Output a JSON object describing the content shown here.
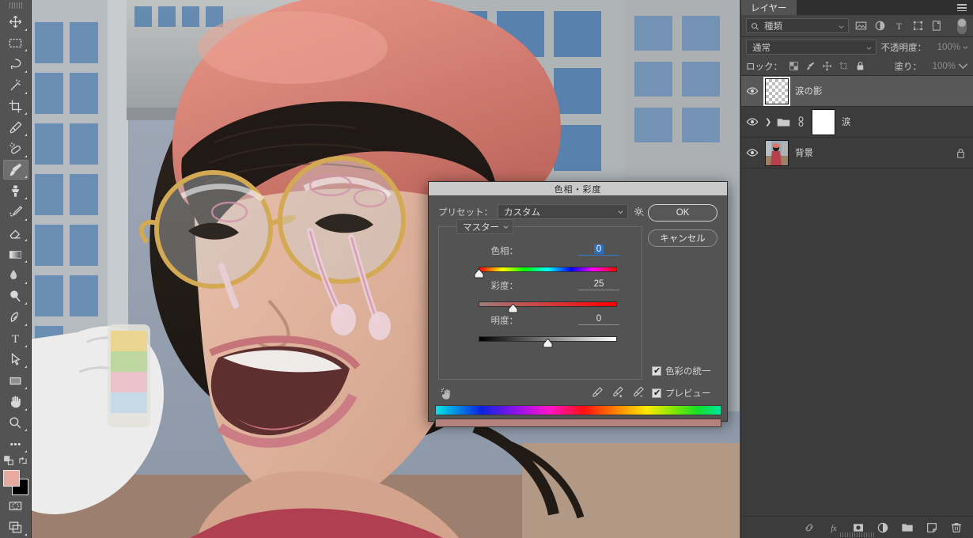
{
  "app": {
    "toolbar": {
      "tools": [
        {
          "name": "move-tool",
          "label": "移動ツール",
          "selected": false
        },
        {
          "name": "marquee-tool",
          "label": "長方形選択ツール",
          "selected": false
        },
        {
          "name": "lasso-tool",
          "label": "なげなわツール",
          "selected": false
        },
        {
          "name": "magic-wand-tool",
          "label": "自動選択ツール",
          "selected": false
        },
        {
          "name": "crop-tool",
          "label": "切り抜きツール",
          "selected": false
        },
        {
          "name": "eyedropper-tool",
          "label": "スポイトツール",
          "selected": false
        },
        {
          "name": "healing-brush-tool",
          "label": "スポット修復ブラシツール",
          "selected": false
        },
        {
          "name": "brush-tool",
          "label": "ブラシツール",
          "selected": true
        },
        {
          "name": "clone-stamp-tool",
          "label": "コピースタンプツール",
          "selected": false
        },
        {
          "name": "history-brush-tool",
          "label": "ヒストリーブラシツール",
          "selected": false
        },
        {
          "name": "eraser-tool",
          "label": "消しゴムツール",
          "selected": false
        },
        {
          "name": "gradient-tool",
          "label": "グラデーションツール",
          "selected": false
        },
        {
          "name": "blur-tool",
          "label": "ぼかしツール",
          "selected": false
        },
        {
          "name": "dodge-tool",
          "label": "覆い焼きツール",
          "selected": false
        },
        {
          "name": "pen-tool",
          "label": "ペンツール",
          "selected": false
        },
        {
          "name": "type-tool",
          "label": "横書き文字ツール",
          "selected": false
        },
        {
          "name": "path-selection-tool",
          "label": "パス選択ツール",
          "selected": false
        },
        {
          "name": "shape-tool",
          "label": "長方形ツール",
          "selected": false
        },
        {
          "name": "hand-tool",
          "label": "手のひらツール",
          "selected": false
        },
        {
          "name": "zoom-tool",
          "label": "ズームツール",
          "selected": false
        },
        {
          "name": "more-tools",
          "label": "ツールバーを編集",
          "selected": false
        }
      ],
      "foreground_color": "#e8a99e",
      "background_color": "#000000",
      "quick_mask_label": "クイックマスクモードで編集",
      "screen_mode_label": "スクリーンモードを切り替え"
    },
    "dialog": {
      "title": "色相・彩度",
      "preset_label": "プリセット：",
      "preset_value": "カスタム",
      "gear_icon": "gear-icon",
      "ok_label": "OK",
      "cancel_label": "キャンセル",
      "channel_value": "マスター",
      "sliders": [
        {
          "name": "hue",
          "label": "色相：",
          "value": "0",
          "active": true,
          "knob_pct": 0,
          "track": "linear-gradient(90deg,#ff0000 0%,#ffff00 17%,#00ff00 33%,#00ffff 50%,#0000ff 67%,#ff00ff 83%,#ff0000 100%)"
        },
        {
          "name": "saturation",
          "label": "彩度：",
          "value": "25",
          "active": false,
          "knob_pct": 25,
          "track": "linear-gradient(90deg,#9d7b7b 0%,#ff0000 100%)"
        },
        {
          "name": "lightness",
          "label": "明度：",
          "value": "0",
          "active": false,
          "knob_pct": 50,
          "track": "linear-gradient(90deg,#000000 0%,#808080 50%,#ffffff 100%)"
        }
      ],
      "colorize_label": "色彩の統一",
      "colorize_checked": true,
      "preview_label": "プレビュー",
      "preview_checked": true,
      "hand_icon": "on-image-adjust-icon",
      "eyedroppers": [
        "eyedropper-icon",
        "eyedropper-add-icon",
        "eyedropper-subtract-icon"
      ],
      "result_bar_color": "#b5827e"
    },
    "layers_panel": {
      "tab_label": "レイヤー",
      "menu_icon": "panel-menu-icon",
      "filter": {
        "kind_label": "種類",
        "search_icon": "search-icon",
        "icons": [
          "filter-pixel-icon",
          "filter-adjustment-icon",
          "filter-type-icon",
          "filter-shape-icon",
          "filter-smartobject-icon"
        ],
        "toggle_label": "フィルターのオン/オフ"
      },
      "blend_mode": "通常",
      "opacity_label": "不透明度：",
      "opacity_value": "100%",
      "lock_label": "ロック：",
      "lock_icons": [
        "lock-transparent-icon",
        "lock-image-icon",
        "lock-position-icon",
        "lock-artboard-icon",
        "lock-all-icon"
      ],
      "fill_label": "塗り：",
      "fill_value": "100%",
      "layers": [
        {
          "name": "涙の影",
          "type": "pixel",
          "selected": true,
          "visible": true,
          "thumb": "checker",
          "locked": false,
          "group": false
        },
        {
          "name": "涙",
          "type": "group",
          "selected": false,
          "visible": true,
          "thumb": "white",
          "locked": false,
          "group": true,
          "linked": true
        },
        {
          "name": "背景",
          "type": "background",
          "selected": false,
          "visible": true,
          "thumb": "photo",
          "locked": true,
          "group": false
        }
      ],
      "bottom_icons": [
        "link-layers-icon",
        "fx-icon",
        "add-mask-icon",
        "new-adjustment-icon",
        "new-group-icon",
        "new-layer-icon",
        "delete-layer-icon"
      ]
    },
    "canvas": {
      "description": "女性の写真（赤いベレー帽・メガネ・涙のような装飾）",
      "background_color": "#8f9bab"
    }
  }
}
